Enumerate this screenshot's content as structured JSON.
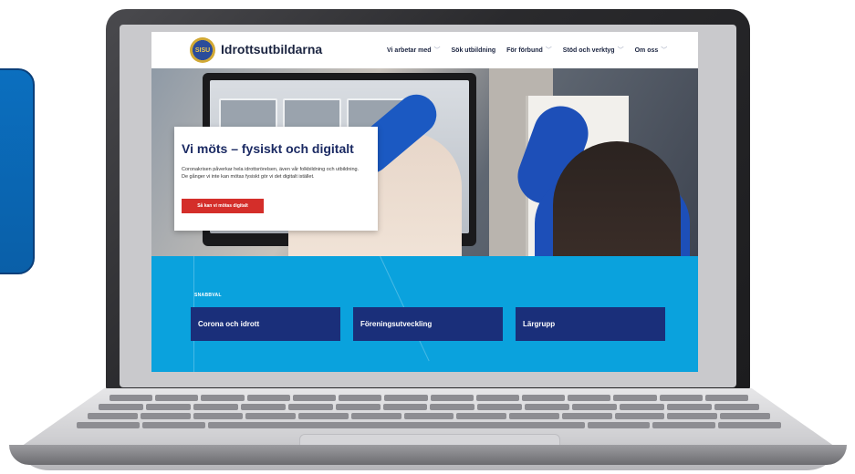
{
  "site": {
    "logo_badge_text": "SISU",
    "logo_text": "Idrottsutbildarna"
  },
  "nav": [
    {
      "label": "Vi arbetar med",
      "chevron": true
    },
    {
      "label": "Sök utbildning",
      "chevron": false
    },
    {
      "label": "För förbund",
      "chevron": true
    },
    {
      "label": "Stöd och verktyg",
      "chevron": true
    },
    {
      "label": "Om oss",
      "chevron": true
    }
  ],
  "hero": {
    "title": "Vi möts – fysiskt och digitalt",
    "text": "Coronakrisen påverkar hela idrottsrörelsen, även vår folkbildning och utbildning. De gånger vi inte kan mötas fysiskt gör vi det digitalt istället.",
    "button_label": "Så kan vi mötas digitalt"
  },
  "quick_links": {
    "label": "SNABBVAL",
    "items": [
      "Corona och idrott",
      "Föreningsutveckling",
      "Lärgrupp"
    ]
  },
  "colors": {
    "header_text": "#1b2440",
    "hero_title": "#1b2a63",
    "button": "#d42e2a",
    "quick_bg": "#0aa2dd",
    "quick_card": "#1a2f7a"
  }
}
